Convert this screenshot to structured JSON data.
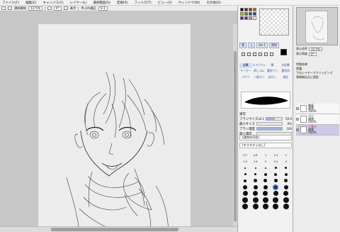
{
  "menu": [
    "ファイル(F)",
    "編集(E)",
    "キャンバス(C)",
    "レイヤー(L)",
    "選択範囲(S)",
    "定規(R)",
    "フィルタ(T)",
    "ビュー(V)",
    "ウィンドウ(W)",
    "その他(O)"
  ],
  "toolbar": {
    "deselect_label": "選択解除",
    "zoom": "12.5%",
    "angle": "0°",
    "view_label": "表示",
    "stabilizer_label": "手ぶれ補正",
    "stabilizer_value": "S-1"
  },
  "tool_panel": {
    "tabs": [
      "色",
      "H",
      "RGB"
    ],
    "color_tabs": [
      "実",
      "上",
      "Ver.1",
      "透明"
    ],
    "swatches": [
      "#000000",
      "#8a0000",
      "#a8281a",
      "#b06a12",
      "#c3b800",
      "#4f8a2a",
      "#16607a",
      "#2438a8",
      "#5a1c8a",
      "#8b1d6a",
      "#9e9e9e",
      "#ffffff"
    ],
    "tools": [
      "鉛筆",
      "エアブラシ",
      "筆",
      "水彩筆",
      "マーカー",
      "消しゴム",
      "選択ペン",
      "選択消",
      "バケツ",
      "二値ペン",
      "ぼかし",
      "指先"
    ],
    "blend_mode": "通常",
    "props": [
      {
        "label": "ブラシサイズ",
        "value": "50.0",
        "prefix": "x0.1",
        "fill": 0.55
      },
      {
        "label": "最小サイズ",
        "value": "0%",
        "fill": 0.0
      },
      {
        "label": "ブラシ濃度",
        "value": "100",
        "fill": 1.0
      },
      {
        "label": "最小濃度",
        "value": "",
        "fill": 0.0
      }
    ],
    "shapes": [
      "[通常の円形]",
      "[テクスチャなし]"
    ],
    "size_labels": [
      "0.7",
      "0.8",
      "1",
      "1.5",
      "2",
      "2.3",
      "2.6",
      "3",
      "3.5",
      "4"
    ]
  },
  "right_panel": {
    "zoom_label": "表示倍率",
    "zoom_value": "12.5%",
    "angle_label": "表示角度",
    "angle_value": "0°",
    "layer_opts": [
      "特殊効果",
      "保護",
      "下のレイヤーでクリッピング",
      "領域検出元に指定"
    ],
    "layers": [
      {
        "name": "線画",
        "mode": "通常",
        "opacity": "100%",
        "selected": false
      },
      {
        "name": "ペン",
        "mode": "通常",
        "opacity": "100%",
        "selected": false
      },
      {
        "name": "下書き",
        "mode": "通常",
        "opacity": "100%",
        "selected": true
      }
    ]
  }
}
